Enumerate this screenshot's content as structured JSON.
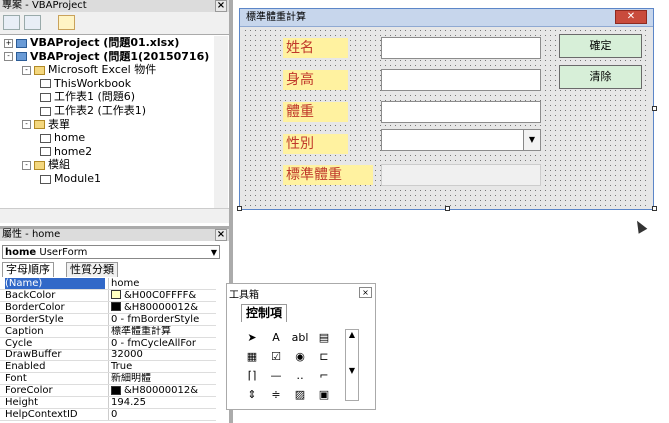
{
  "project_pane": {
    "title": "專案 - VBAProject",
    "tree": [
      {
        "label": "VBAProject (問題01.xlsx)",
        "level": 0,
        "icon": "vba-project-icon",
        "expander": "+",
        "bold": true
      },
      {
        "label": "VBAProject (問題1(20150716)",
        "level": 0,
        "icon": "vba-project-icon",
        "expander": "-",
        "bold": true
      },
      {
        "label": "Microsoft Excel 物件",
        "level": 1,
        "icon": "folder-icon",
        "expander": "-",
        "bold": false
      },
      {
        "label": "ThisWorkbook",
        "level": 2,
        "icon": "workbook-icon",
        "expander": "",
        "bold": false
      },
      {
        "label": "工作表1 (問題6)",
        "level": 2,
        "icon": "worksheet-icon",
        "expander": "",
        "bold": false
      },
      {
        "label": "工作表2 (工作表1)",
        "level": 2,
        "icon": "worksheet-icon",
        "expander": "",
        "bold": false
      },
      {
        "label": "表單",
        "level": 1,
        "icon": "folder-icon",
        "expander": "-",
        "bold": false
      },
      {
        "label": "home",
        "level": 2,
        "icon": "form-icon",
        "expander": "",
        "bold": false
      },
      {
        "label": "home2",
        "level": 2,
        "icon": "form-icon",
        "expander": "",
        "bold": false
      },
      {
        "label": "模組",
        "level": 1,
        "icon": "folder-icon",
        "expander": "-",
        "bold": false
      },
      {
        "label": "Module1",
        "level": 2,
        "icon": "module-icon",
        "expander": "",
        "bold": false
      }
    ]
  },
  "properties_pane": {
    "title": "屬性 - home",
    "object_name": "home",
    "object_type": "UserForm",
    "tabs": [
      "字母順序",
      "性質分類"
    ],
    "rows": [
      {
        "name": "(Name)",
        "value": "home",
        "swatch": ""
      },
      {
        "name": "BackColor",
        "value": "&H00C0FFFF&",
        "swatch": "#ffffc0"
      },
      {
        "name": "BorderColor",
        "value": "&H80000012&",
        "swatch": "#000000"
      },
      {
        "name": "BorderStyle",
        "value": "0 - fmBorderStyle",
        "swatch": ""
      },
      {
        "name": "Caption",
        "value": "標準體重計算",
        "swatch": ""
      },
      {
        "name": "Cycle",
        "value": "0 - fmCycleAllFor",
        "swatch": ""
      },
      {
        "name": "DrawBuffer",
        "value": "32000",
        "swatch": ""
      },
      {
        "name": "Enabled",
        "value": "True",
        "swatch": ""
      },
      {
        "name": "Font",
        "value": "新細明體",
        "swatch": ""
      },
      {
        "name": "ForeColor",
        "value": "&H80000012&",
        "swatch": "#000000"
      },
      {
        "name": "Height",
        "value": "194.25",
        "swatch": ""
      },
      {
        "name": "HelpContextID",
        "value": "0",
        "swatch": ""
      }
    ]
  },
  "form": {
    "caption": "標準體重計算",
    "labels": [
      "姓名",
      "身高",
      "體重",
      "性別",
      "標準體重"
    ],
    "confirm_label": "確定",
    "clear_label": "清除"
  },
  "toolbox": {
    "title": "工具箱",
    "tab": "控制項",
    "tools": [
      "➤",
      "A",
      "abl",
      "▤",
      "▦",
      "☑",
      "◉",
      "⊏",
      "⌈⌉",
      "—",
      "‥",
      "⌐",
      "⇕",
      "≑",
      "▨",
      "▣"
    ]
  }
}
